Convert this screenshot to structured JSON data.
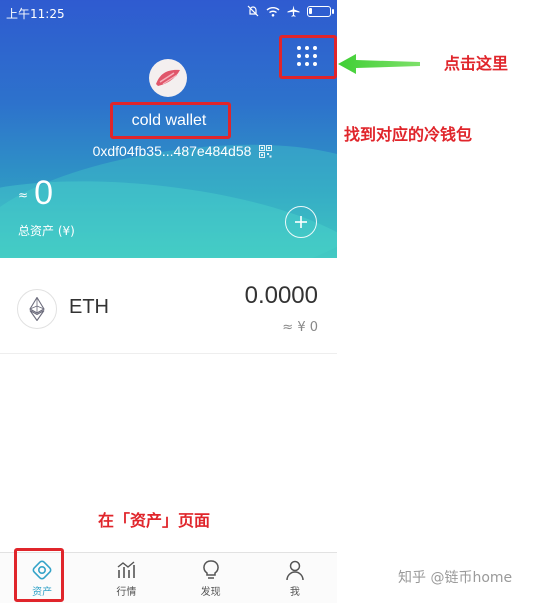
{
  "status_bar": {
    "time": "上午11:25"
  },
  "wallet": {
    "name": "cold wallet",
    "address": "0xdf04fb35...487e484d58",
    "approx_sign": "≈",
    "total_value": "0",
    "total_label": "总资产 (¥)"
  },
  "assets": [
    {
      "symbol": "ETH",
      "amount": "0.0000",
      "fiat_value": "≈ ¥ 0"
    }
  ],
  "tabs": [
    {
      "label": "资产",
      "icon": "assets-icon",
      "active": true
    },
    {
      "label": "行情",
      "icon": "market-chart-icon",
      "active": false
    },
    {
      "label": "发现",
      "icon": "lightbulb-icon",
      "active": false
    },
    {
      "label": "我",
      "icon": "profile-icon",
      "active": false
    }
  ],
  "annotations": {
    "click_here": "点击这里",
    "find_wallet": "找到对应的冷钱包",
    "assets_page": "在「资产」页面"
  },
  "watermark": "知乎 @链币home",
  "colors": {
    "accent": "#34a3c8",
    "annotation_red": "#e0252b",
    "arrow_green": "#4cd43a",
    "header_top": "#2f5bd0",
    "header_bottom": "#3cc0bd"
  }
}
